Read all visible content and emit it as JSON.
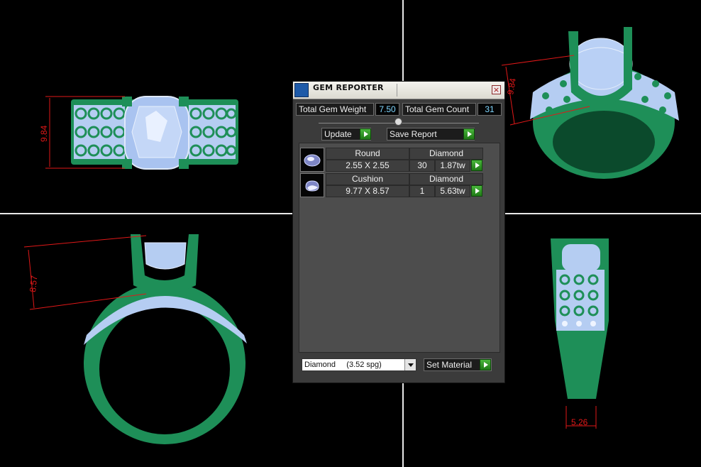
{
  "viewports": {
    "top": {
      "dimension": "9.84"
    },
    "perspective": {
      "dimension": "9.84"
    },
    "front": {
      "dimension": "8.57"
    },
    "side": {
      "dimension": "5.26"
    }
  },
  "gem_reporter": {
    "title": "GEM REPORTER",
    "close_icon": "close-icon",
    "total_weight_label": "Total Gem Weight",
    "total_weight_value": "7.50",
    "total_count_label": "Total Gem Count",
    "total_count_value": "31",
    "update_label": "Update",
    "save_report_label": "Save Report",
    "gems": [
      {
        "shape": "Round",
        "material": "Diamond",
        "size": "2.55 X 2.55",
        "count": "30",
        "weight": "1.87tw"
      },
      {
        "shape": "Cushion",
        "material": "Diamond",
        "size": "9.77 X 8.57",
        "count": "1",
        "weight": "5.63tw"
      }
    ],
    "material_select": "Diamond     (3.52 spg)",
    "set_material_label": "Set Material"
  },
  "colors": {
    "metal": "#1f8a55",
    "gem": "#aac6f2",
    "dimension": "#e01818",
    "panel": "#3b3b3b"
  }
}
